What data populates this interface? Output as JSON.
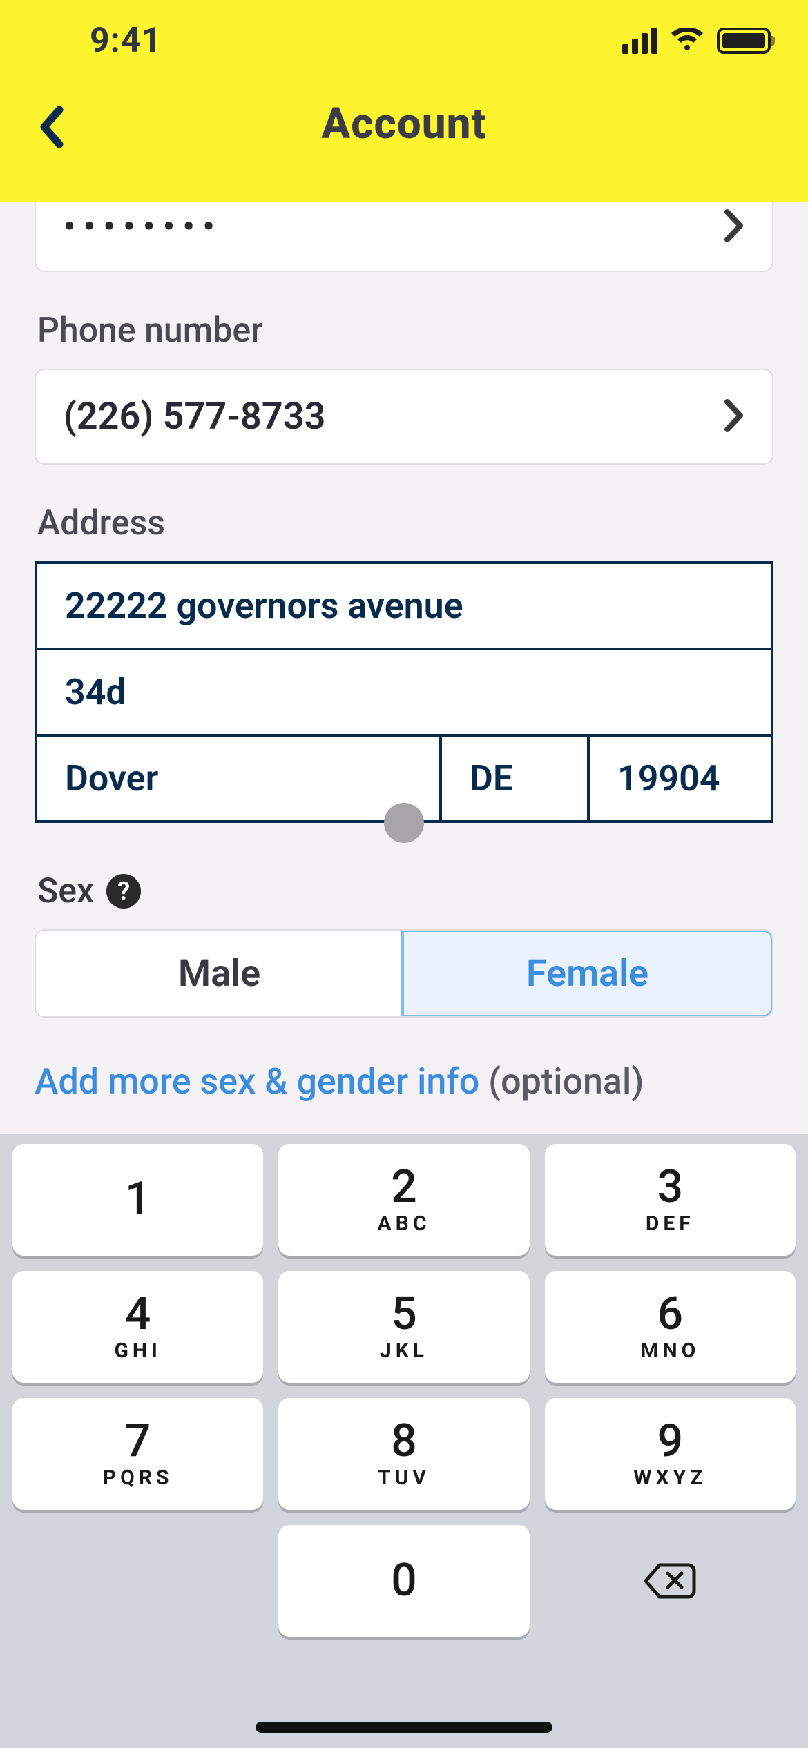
{
  "status": {
    "time": "9:41"
  },
  "header": {
    "title": "Account"
  },
  "password": {
    "masked": "••••••••"
  },
  "labels": {
    "phone": "Phone number",
    "address": "Address",
    "sex": "Sex",
    "optional": "(optional)"
  },
  "phone": {
    "display": "(226) 577-8733"
  },
  "address": {
    "line1": "22222 governors avenue",
    "line2": "34d",
    "city": "Dover",
    "state": "DE",
    "zip": "19904"
  },
  "sex": {
    "male": "Male",
    "female": "Female",
    "selected": "Female",
    "more_link": "Add more sex & gender info "
  },
  "keyboard": {
    "keys": [
      [
        {
          "d": "1",
          "l": ""
        },
        {
          "d": "2",
          "l": "ABC"
        },
        {
          "d": "3",
          "l": "DEF"
        }
      ],
      [
        {
          "d": "4",
          "l": "GHI"
        },
        {
          "d": "5",
          "l": "JKL"
        },
        {
          "d": "6",
          "l": "MNO"
        }
      ],
      [
        {
          "d": "7",
          "l": "PQRS"
        },
        {
          "d": "8",
          "l": "TUV"
        },
        {
          "d": "9",
          "l": "WXYZ"
        }
      ]
    ],
    "zero": {
      "d": "0",
      "l": ""
    }
  }
}
